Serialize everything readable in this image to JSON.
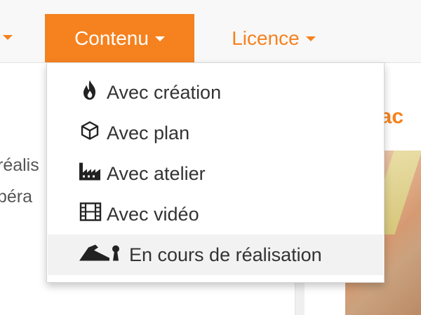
{
  "navbar": {
    "items": [
      {
        "label": "Contenu",
        "active": true
      },
      {
        "label": "Licence",
        "active": false
      }
    ]
  },
  "dropdown": {
    "items": [
      {
        "label": "Avec création",
        "icon": "fire-icon"
      },
      {
        "label": "Avec plan",
        "icon": "cube-icon"
      },
      {
        "label": "Avec atelier",
        "icon": "factory-icon"
      },
      {
        "label": "Avec vidéo",
        "icon": "film-icon"
      },
      {
        "label": "En cours de réalisation",
        "icon": "hand-plane-icon",
        "highlighted": true
      }
    ]
  },
  "background": {
    "left_text_line1": "réalis",
    "left_text_line2": "péra",
    "right_heading": "çac"
  },
  "colors": {
    "accent": "#f5821f",
    "menu_text": "#333333",
    "hover": "#f2f2f2"
  }
}
